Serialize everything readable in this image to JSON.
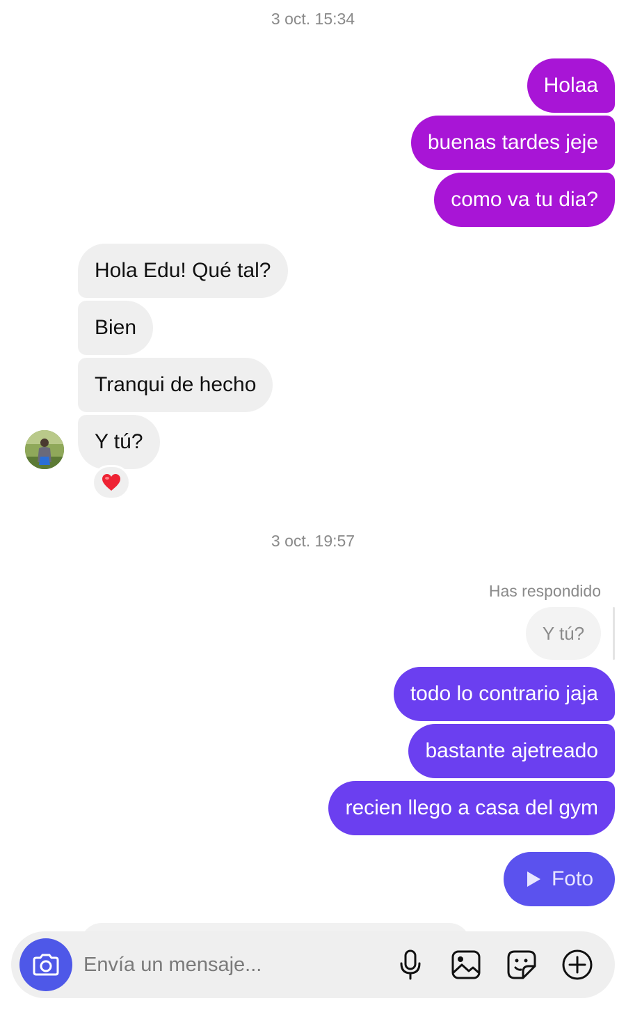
{
  "conversation": {
    "timestamp_1": "3 oct. 15:34",
    "outgoing_1": [
      "Holaa",
      "buenas tardes jeje",
      "como va tu dia?"
    ],
    "incoming": [
      "Hola Edu! Qué tal?",
      "Bien",
      "Tranqui de hecho",
      "Y tú?"
    ],
    "reaction": "❤️",
    "timestamp_2": "3 oct. 19:57",
    "reply_label": "Has respondido",
    "replied_message": "Y tú?",
    "outgoing_2": [
      "todo lo contrario jaja",
      "bastante ajetreado",
      "recien llego a casa del gym"
    ],
    "media_label": "Foto",
    "colors": {
      "outgoing_early": "#a815d6",
      "outgoing_late": "#6b3ff0",
      "media": "#5b52ee",
      "incoming": "#efefef"
    }
  },
  "composer": {
    "placeholder": "Envía un mensaje...",
    "icons": [
      "camera-icon",
      "microphone-icon",
      "gallery-icon",
      "sticker-icon",
      "add-icon"
    ]
  }
}
